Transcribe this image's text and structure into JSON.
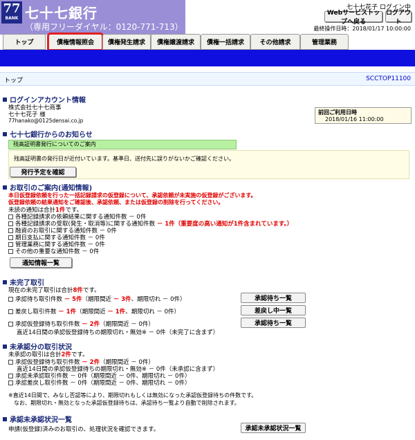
{
  "header": {
    "logo_num": "77",
    "logo_sub": "BANK",
    "bank_name": "七十七銀行",
    "phone": "（専用フリーダイヤル：0120-771-713）",
    "user_status": "七十七花子 ログイン中",
    "web_top_button": "Webサービストップへ戻る",
    "logout_button": "ログアウト",
    "last_update": "最終操作日時：2018/01/17 10:00:00"
  },
  "tabs": [
    "トップ",
    "債権情報照会",
    "債権発生請求",
    "債権譲渡請求",
    "債権一括請求",
    "その他請求",
    "管理業務"
  ],
  "page": {
    "title": "トップ",
    "screen_id": "SCCTOP11100"
  },
  "login_account": {
    "heading": "ログインアカウント情報",
    "company": "株式会社七十七商事",
    "user": "七十七花子 様",
    "email": "77hanako@0125densai.co.jp",
    "last_login_label": "前回ご利用日時",
    "last_login_value": "2018/01/16 11:00:00"
  },
  "notices": {
    "heading": "七十七銀行からのお知らせ",
    "title": "残高証明書発行についてのご案内",
    "body": "残高証明書の発行日が近付いています。基準日、送付先に誤りがないかご確認ください。",
    "button": "発行予定を確認"
  },
  "transactions_info": {
    "heading": "お取引のご案内(通知情報)",
    "warning1": "本日仮登録依頼を行った一括記録請求の仮登録について、承認依頼が未実施の仮登録がございます。",
    "warning2": "仮登録依頼の結果通知をご確認後、承認依頼、または仮登録の削除を行ってください。",
    "unread_prefix": "未読の通知は合計",
    "unread_count": "1件",
    "unread_suffix": "です。",
    "items": [
      {
        "label": "各種記録請求の依頼結果に関する通知件数",
        "count": "－ 0件",
        "note": "",
        "red": false
      },
      {
        "label": "各種記録請求の受取(発生・取消等)に関する通知件数",
        "count": "－ 1件",
        "note": "（重要度の高い通知が1件含まれています。）",
        "red": true
      },
      {
        "label": "融資のお取引に関する通知件数",
        "count": "－ 0件",
        "note": "",
        "red": false
      },
      {
        "label": "期日支払に関する通知件数",
        "count": "－ 0件",
        "note": "",
        "red": false
      },
      {
        "label": "管理業務に関する通知件数",
        "count": "－ 0件",
        "note": "",
        "red": false
      },
      {
        "label": "その他の重要な通知件数",
        "count": "－ 0件",
        "note": "",
        "red": false
      }
    ],
    "button": "通知情報一覧"
  },
  "pending": {
    "heading": "未完了取引",
    "summary_prefix": "現在の未完了取引は合計",
    "summary_count": "8件",
    "summary_suffix": "です。",
    "row1_label": "承認待ち取引件数",
    "row1_count": "－ 5件",
    "row1_mid": "（期限間近",
    "row1_near": "－ 3件",
    "row1_rest": "、期限切れ － 0件）",
    "row1_button": "承認待ち一覧",
    "row2_label": "差戻し取引件数",
    "row2_count": "－ 1件",
    "row2_mid": "（期限間近",
    "row2_near": "－ 1件",
    "row2_rest": "、期限切れ － 0件）",
    "row2_button": "差戻し中一覧",
    "row3_label": "承認仮登録待ち取引件数",
    "row3_count": "－ 2件",
    "row3_rest": "（期限間近 － 0件）",
    "row3_sub": "直近14日間の承認仮登録待ちの期限切れ・無効※ － 0件（未完了に含まず）",
    "row3_button": "承認待ち一覧"
  },
  "unapproved": {
    "heading": "未承認分の取引状況",
    "summary_prefix": "未承認の取引は合計",
    "summary_count": "2件",
    "summary_suffix": "です。",
    "row1_label": "承認仮登録待ち取引件数",
    "row1_count": "－ 2件",
    "row1_rest": "（期限間近 － 0件）",
    "row1_sub": "直近14日間の承認仮登録待ちの期限切れ・無効※ － 0件（未承認に含まず）",
    "row2": "承認未承認取引件数 － 0件（期限間近 － 0件、期限切れ － 0件）",
    "row3": "承認差戻し取引件数 － 0件（期限間近 － 0件、期限切れ － 0件）",
    "footnote1": "※直近14日間で、みなし否認等により、期限切れもしくは無効になった承認仮登録待ちの件数です。",
    "footnote2": "なお、期限切れ・無効となった承認仮登録待ちは、承認待ち一覧より自動で削除されます。"
  },
  "approval_list": {
    "heading": "承認未承認状況一覧",
    "body": "申請(仮登録)済みのお取引の、処理状況を確認できます。",
    "button": "承認未承認状況一覧"
  }
}
